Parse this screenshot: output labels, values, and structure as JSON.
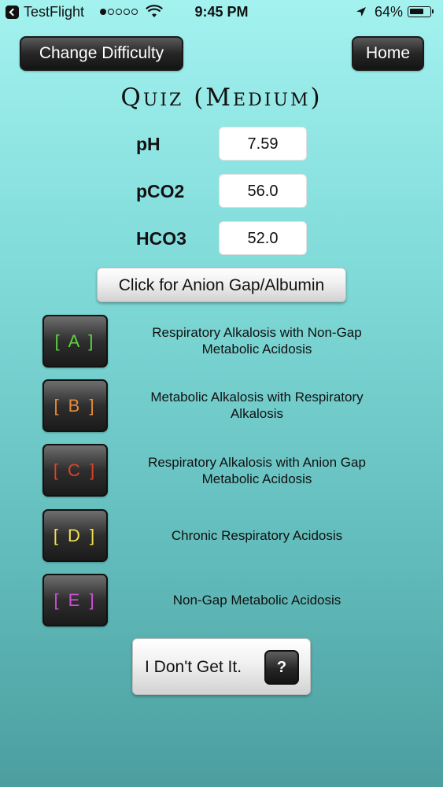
{
  "status_bar": {
    "app": "TestFlight",
    "time": "9:45 PM",
    "battery": "64%",
    "signal_icon": "signal-dots-icon",
    "wifi_icon": "wifi-icon",
    "location_icon": "location-arrow-icon",
    "battery_icon": "battery-icon",
    "back_icon": "back-chevron-icon"
  },
  "nav": {
    "change_difficulty": "Change Difficulty",
    "home": "Home"
  },
  "title": "Quiz (Medium)",
  "params": {
    "ph": {
      "label": "pH",
      "value": "7.59"
    },
    "pco2": {
      "label": "pCO2",
      "value": "56.0"
    },
    "hco3": {
      "label": "HCO3",
      "value": "52.0"
    }
  },
  "anion_button": "Click for Anion Gap/Albumin",
  "options": [
    {
      "letter": "[ A ]",
      "text": "Respiratory Alkalosis with Non-Gap Metabolic Acidosis",
      "color": "#5fd243"
    },
    {
      "letter": "[ B ]",
      "text": "Metabolic Alkalosis with Respiratory Alkalosis",
      "color": "#e98b35"
    },
    {
      "letter": "[ C ]",
      "text": "Respiratory Alkalosis with Anion Gap Metabolic Acidosis",
      "color": "#d8442e"
    },
    {
      "letter": "[ D ]",
      "text": "Chronic Respiratory Acidosis",
      "color": "#f2e14a"
    },
    {
      "letter": "[ E ]",
      "text": "Non-Gap Metabolic Acidosis",
      "color": "#cf4fd8"
    }
  ],
  "dont_get": {
    "label": "I Don't Get It.",
    "icon": "?"
  }
}
